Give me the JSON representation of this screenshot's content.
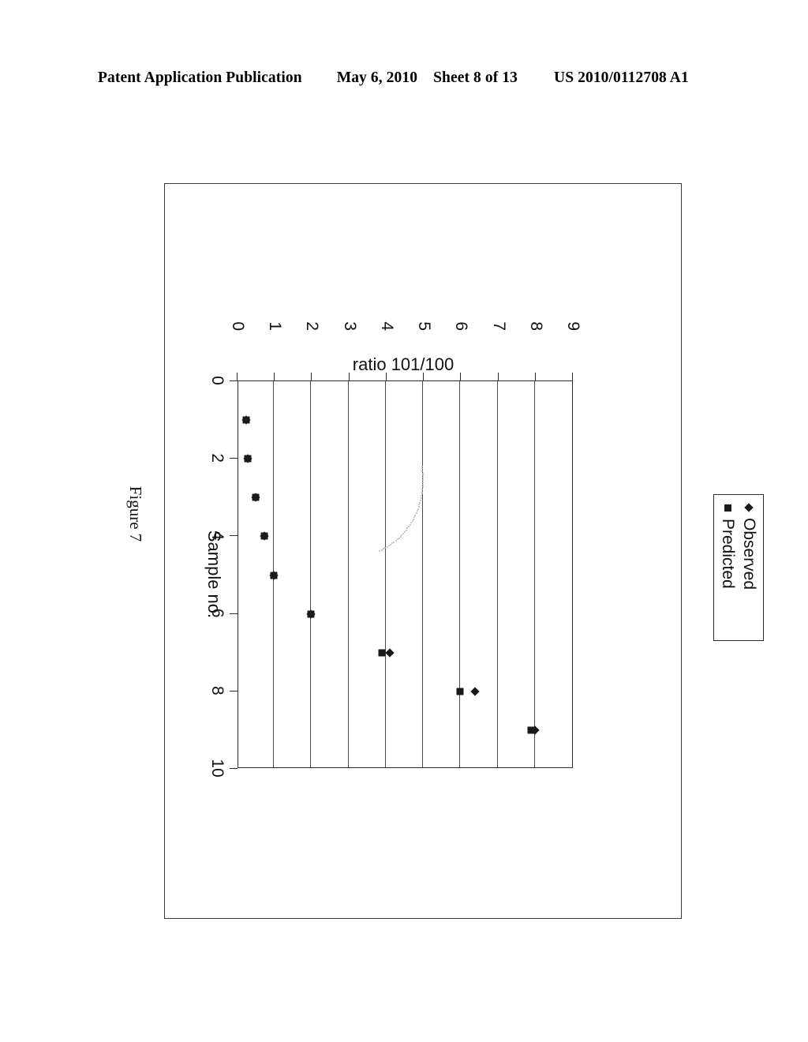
{
  "header": {
    "publication": "Patent Application Publication",
    "date": "May 6, 2010",
    "sheet": "Sheet 8 of 13",
    "patent_number": "US 2010/0112708 A1"
  },
  "figure": {
    "caption": "Figure 7"
  },
  "legend": {
    "observed_label": "Observed",
    "predicted_label": "Predicted",
    "observed_marker": "diamond-marker",
    "predicted_marker": "square-marker"
  },
  "chart_data": {
    "type": "scatter",
    "title": "",
    "xlabel": "Sample no.",
    "ylabel": "ratio 101/100",
    "xlim": [
      0,
      10
    ],
    "ylim": [
      0,
      9
    ],
    "xticks": [
      0,
      2,
      4,
      6,
      8,
      10
    ],
    "yticks": [
      0,
      1,
      2,
      3,
      4,
      5,
      6,
      7,
      8,
      9
    ],
    "xtick_labels": [
      "0",
      "2",
      "4",
      "6",
      "8",
      "10"
    ],
    "ytick_labels": [
      "0",
      "1",
      "2",
      "3",
      "4",
      "5",
      "6",
      "7",
      "8",
      "9"
    ],
    "grid": "horizontal",
    "legend_position": "top-center",
    "x": [
      1,
      2,
      3,
      4,
      5,
      6,
      7,
      8,
      9
    ],
    "series": [
      {
        "name": "Observed",
        "marker": "diamond",
        "color": "#1a1a1a",
        "values": [
          0.25,
          0.3,
          0.5,
          0.75,
          1.0,
          2.0,
          4.1,
          6.4,
          8.0
        ]
      },
      {
        "name": "Predicted",
        "marker": "square",
        "color": "#1a1a1a",
        "values": [
          0.25,
          0.3,
          0.5,
          0.75,
          1.0,
          2.0,
          3.9,
          6.0,
          7.9
        ]
      }
    ]
  },
  "colors": {
    "ink": "#1a1a1a",
    "frame": "#2b2b2b",
    "outer_border": "#3a3a3a",
    "background": "#ffffff"
  }
}
